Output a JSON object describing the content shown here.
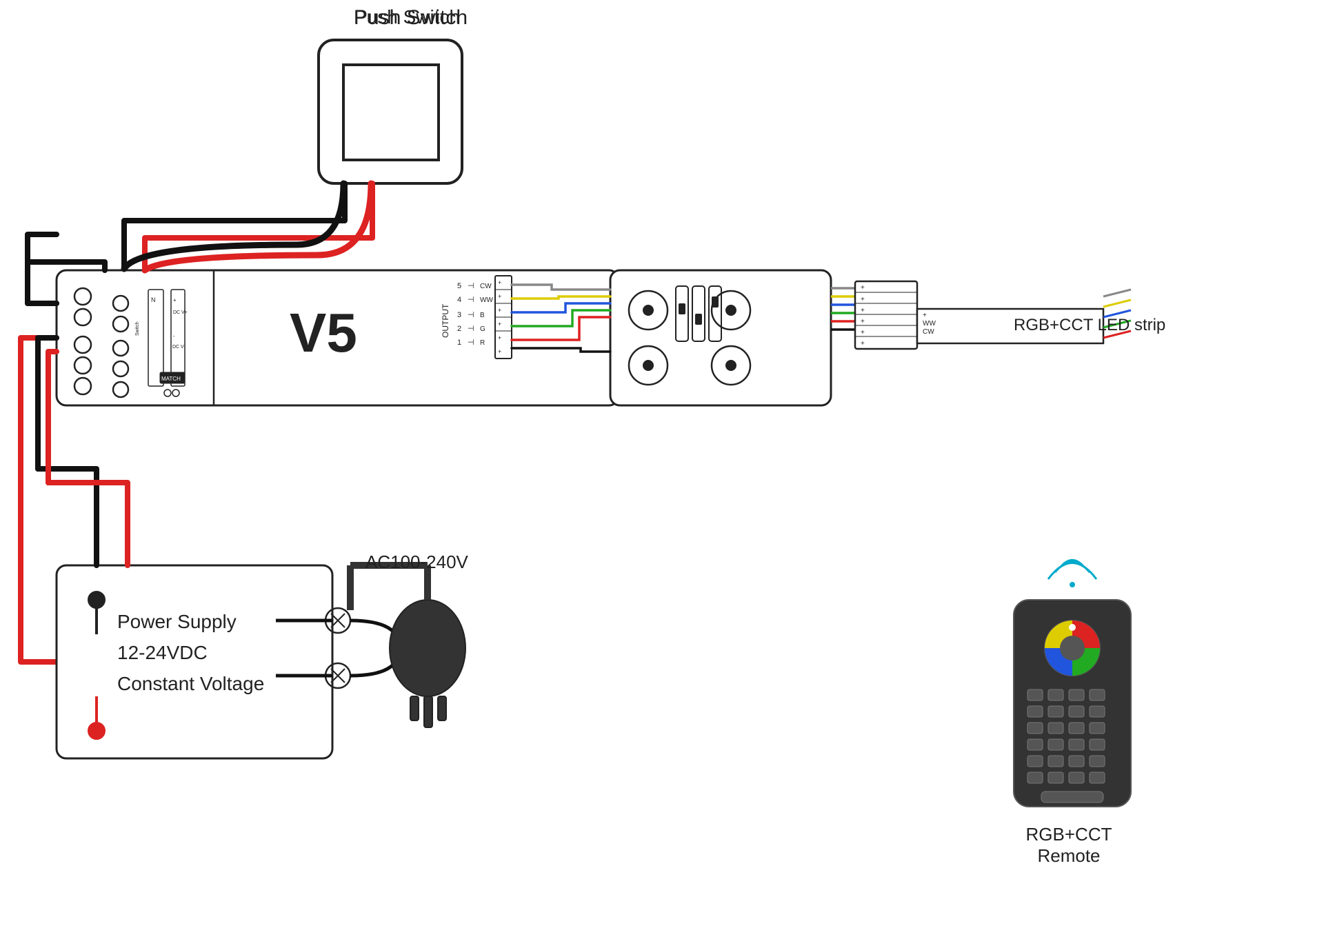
{
  "labels": {
    "push_switch": "Push Switch",
    "v5": "V5",
    "rgb_cct_led_strip": "RGB+CCT LED strip",
    "power_supply_line1": "Power Supply",
    "power_supply_line2": "12-24VDC",
    "power_supply_line3": "Constant Voltage",
    "ac_voltage": "AC100-240V",
    "rgb_cct_remote": "RGB+CCT Remote"
  },
  "colors": {
    "black": "#222222",
    "red": "#e02020",
    "white": "#ffffff",
    "wire_black": "#111111",
    "wire_red": "#dd2222",
    "wire_green": "#22aa22",
    "wire_blue": "#2255dd",
    "wire_yellow": "#ddcc00",
    "wire_white": "#888888",
    "wifi_cyan": "#00aacc"
  }
}
